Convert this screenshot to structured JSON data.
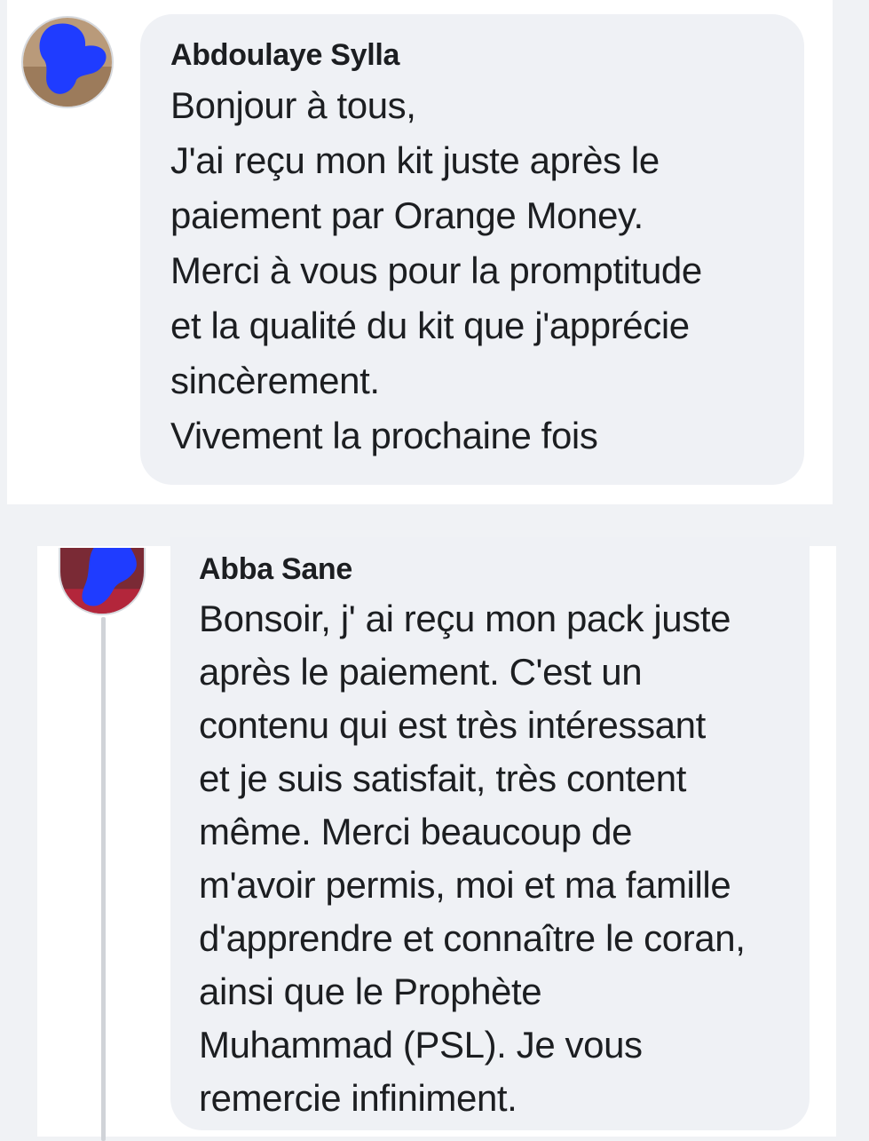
{
  "comments": [
    {
      "author": "Abdoulaye Sylla",
      "lines": [
        "Bonjour à tous,",
        "J'ai reçu mon kit juste après le",
        "paiement par Orange Money.",
        "Merci à vous pour la promptitude",
        "et la qualité du kit que j'apprécie",
        "sincèrement.",
        "Vivement la prochaine fois"
      ]
    },
    {
      "author": "Abba Sane",
      "lines": [
        "Bonsoir, j' ai reçu mon pack juste",
        "après le paiement. C'est un",
        "contenu qui est très intéressant",
        "et je suis satisfait, très content",
        "même. Merci beaucoup de",
        "m'avoir permis, moi et ma famille",
        "d'apprendre et connaître le coran,",
        "ainsi que le Prophète",
        "Muhammad (PSL). Je vous",
        "remercie infiniment."
      ]
    }
  ],
  "colors": {
    "background": "#f0f2f5",
    "bubble": "#eff1f5",
    "text": "#1c1e21",
    "avatar_blur": "#1f3cff"
  }
}
